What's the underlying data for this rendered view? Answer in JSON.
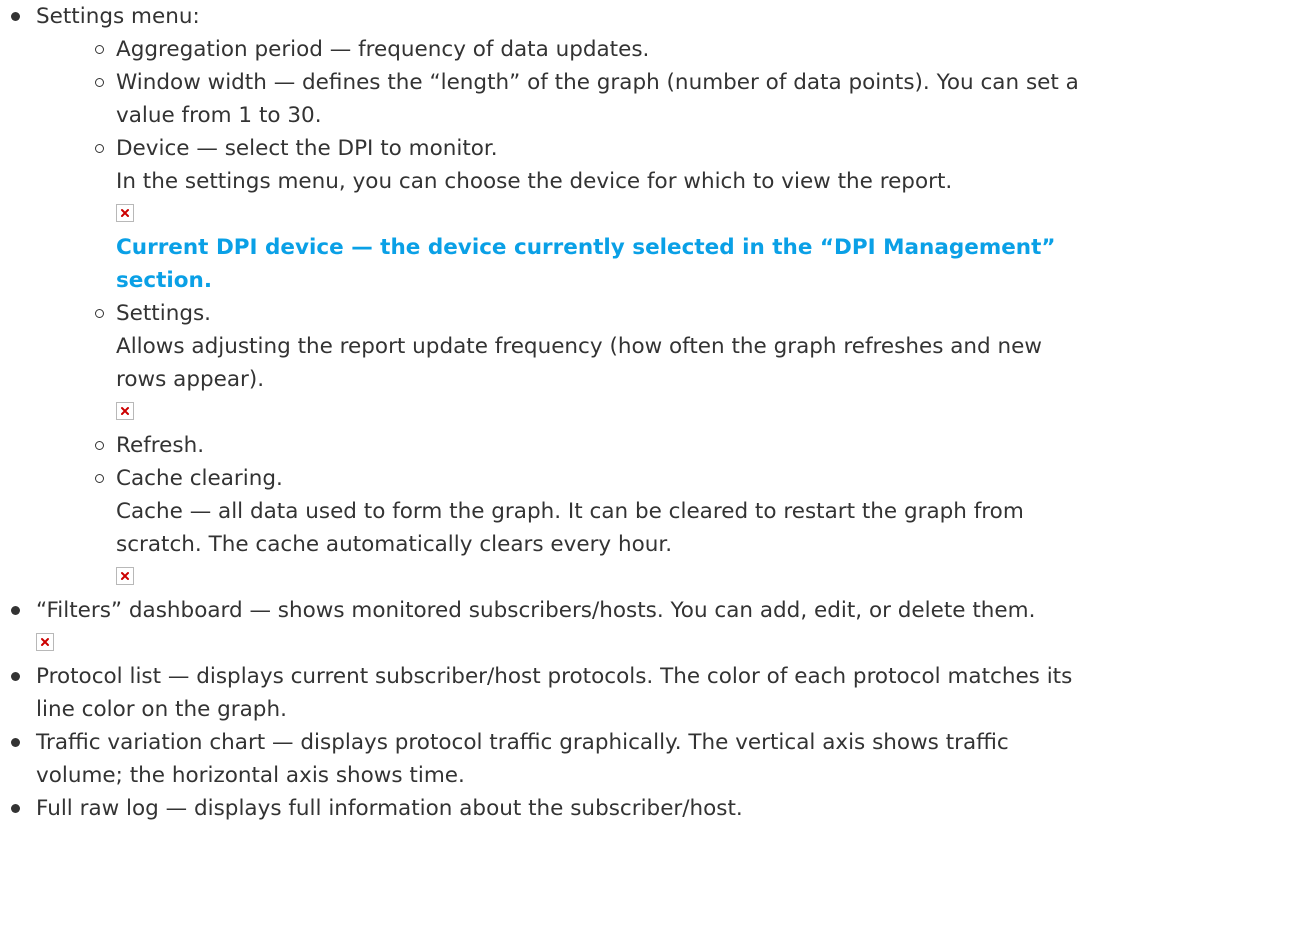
{
  "items": [
    {
      "label": "Settings menu:",
      "children": [
        {
          "text": "Aggregation period — frequency of data updates."
        },
        {
          "lines": [
            "Window width — defines the “length” of the graph (number of data points). You can set a",
            "value from 1 to 30."
          ]
        },
        {
          "text": "Device — select the DPI to monitor.",
          "desc": "In the settings menu, you can choose the device for which to view the report.",
          "note_lines": [
            "Current DPI device — the device currently selected in the “DPI Management”",
            "section."
          ]
        },
        {
          "text": "Settings.",
          "desc_lines": [
            "Allows adjusting the report update frequency (how often the graph refreshes and new",
            "rows appear)."
          ]
        },
        {
          "text": "Refresh."
        },
        {
          "text": "Cache clearing.",
          "desc_lines": [
            "Cache — all data used to form the graph. It can be cleared to restart the graph from",
            "scratch. The cache automatically clears every hour."
          ]
        }
      ]
    },
    {
      "label": "“Filters” dashboard — shows monitored subscribers/hosts. You can add, edit, or delete them."
    },
    {
      "lines": [
        "Protocol list — displays current subscriber/host protocols. The color of each protocol matches its",
        "line color on the graph."
      ]
    },
    {
      "lines": [
        "Traffic variation chart — displays protocol traffic graphically. The vertical axis shows traffic",
        "volume; the horizontal axis shows time."
      ]
    },
    {
      "label": "Full raw log — displays full information about the subscriber/host."
    }
  ],
  "colors": {
    "text": "#333333",
    "note": "#0aa0e6",
    "broken_image_icon": "#cc0000"
  }
}
